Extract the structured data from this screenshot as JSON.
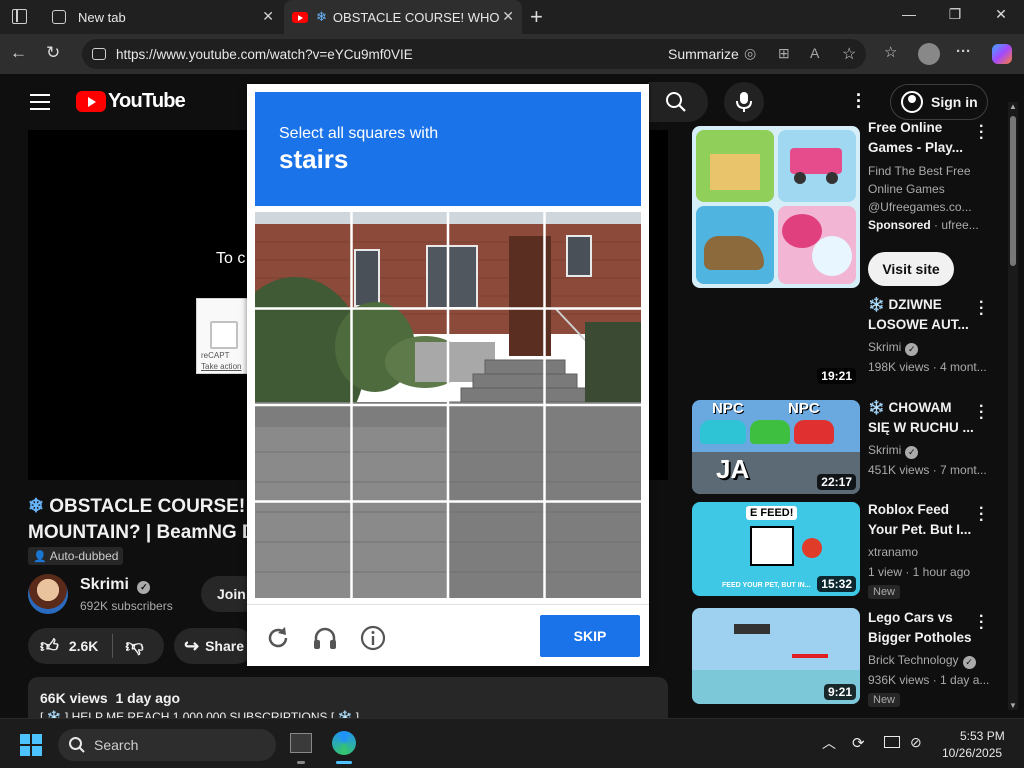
{
  "browser": {
    "tabs": [
      {
        "label": "New tab"
      },
      {
        "label": "OBSTACLE COURSE! WHO WIL"
      }
    ],
    "url": "https://www.youtube.com/watch?v=eYCu9mf0VIE",
    "summarize_label": "Summarize"
  },
  "youtube": {
    "logo_text": "YouTube",
    "sign_in_label": "Sign in",
    "overlay_text": "To c",
    "recaptcha_small_text": "reCAPT",
    "recaptcha_action_text": "Take action",
    "video_title_line1": "OBSTACLE COURSE!",
    "video_title_line2": "MOUNTAIN? | BeamNG D",
    "auto_dubbed": "Auto-dubbed",
    "channel_name": "Skrimi",
    "subscribers": "692K subscribers",
    "join_label": "Join",
    "likes": "2.6K",
    "share_label": "Share",
    "views_date": "66K views  1 day ago",
    "description_peek": "[ ❄️ ] HELP ME REACH 1,000,000 SUBSCRIPTIONS [ ❄️ ]"
  },
  "sidebar": {
    "ad": {
      "title_line1": "Free Online",
      "title_line2": "Games - Play...",
      "desc_line1": "Find The Best Free",
      "desc_line2": "Online Games",
      "desc_line3": "@Ufreegames.co...",
      "sponsored": "Sponsored",
      "sponsor_domain": "· ufree...",
      "visit_label": "Visit site"
    },
    "videos": [
      {
        "title_line1": "❄️ DZIWNE",
        "title_line2": "LOSOWE AUT...",
        "channel": "Skrimi",
        "meta": "198K views · 4 mont...",
        "duration": "19:21",
        "badge": ""
      },
      {
        "title_line1": "❄️ CHOWAM",
        "title_line2": "SIĘ W RUCHU ...",
        "channel": "Skrimi",
        "meta": "451K views · 7 mont...",
        "duration": "22:17",
        "badge": ""
      },
      {
        "title_line1": "Roblox Feed",
        "title_line2": "Your Pet. But I...",
        "channel": "xtranamo",
        "meta": "1 view · 1 hour ago",
        "duration": "15:32",
        "badge": "New"
      },
      {
        "title_line1": "Lego Cars vs",
        "title_line2": "Bigger Potholes",
        "channel": "Brick Technology",
        "meta": "936K views · 1 day a...",
        "duration": "9:21",
        "badge": "New"
      }
    ],
    "thumb_labels": {
      "npc_left": "NPC",
      "npc_right": "NPC",
      "ja": "JA",
      "efeed": "E FEED!",
      "roblox_caption": "FEED YOUR PET, BUT IN..."
    }
  },
  "captcha": {
    "instruction": "Select all squares with",
    "target": "stairs",
    "skip_label": "SKIP"
  },
  "taskbar": {
    "search_placeholder": "Search",
    "time": "5:53 PM",
    "date": "10/26/2025"
  },
  "colors": {
    "captcha_blue": "#1a73e8",
    "youtube_red": "#ff0000",
    "page_bg": "#0f0f0f"
  }
}
